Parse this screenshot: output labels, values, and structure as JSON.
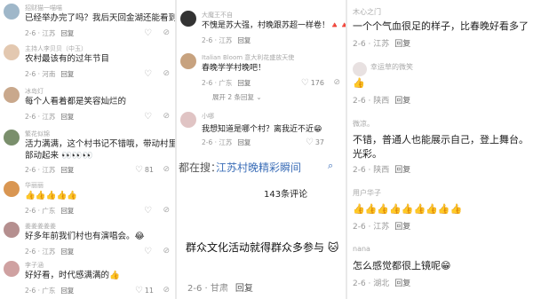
{
  "left": [
    {
      "user": "招财猫一喵喵",
      "text": "已经举办完了吗？我后天回金湖还能看到吗？",
      "time": "2-6 · 江苏",
      "likes": "",
      "color": "#9fb7c9"
    },
    {
      "user": "主持人李贝贝（中玉）",
      "text": "农村最该有的过年节目",
      "time": "2-6 · 河南",
      "likes": "",
      "color": "#e3c8b0"
    },
    {
      "user": "冰岛灯",
      "text": "每个人看着都是笑容灿烂的",
      "time": "2-6 · 江苏",
      "likes": "",
      "color": "#c9a88c"
    },
    {
      "user": "繁花似锦",
      "text": "活力满满，这个村书记不错哦，带动村里人全",
      "text2": "部动起来 👀👀👀",
      "time": "2-6 · 江苏",
      "likes": "81",
      "color": "#7a8f6c"
    },
    {
      "user": "华丽丽",
      "text": "👍👍👍👍👍",
      "time": "2-6 · 广东",
      "likes": "",
      "color": "#d99652"
    },
    {
      "user": "姜姜姜姜姜",
      "text": "好多年前我们村也有演唱会。😂",
      "time": "2-6 · 江苏",
      "likes": "",
      "color": "#b58f8f"
    },
    {
      "user": "李子涵",
      "text": "好好看，时代感满满的👍",
      "time": "2-6 · 广东",
      "likes": "11",
      "color": "#cfa1a1"
    }
  ],
  "middle": {
    "comments": [
      {
        "user": "大魔王不自",
        "text": "不愧是苏大强，村晚跟苏超一样卷！🔺🔺🔺",
        "time": "2-6 · 江苏",
        "likes": "",
        "color": "#333333"
      },
      {
        "user": "Italian Bloom 意大利花盛放天使",
        "text": "春晚学学村晚吧！",
        "time": "2-6 · 广东",
        "likes": "176",
        "color": "#c7a27f"
      },
      {
        "user": "小哪",
        "text": "我想知道是哪个村？离我近不近😁",
        "time": "2-6 · 江苏",
        "likes": "37",
        "color": "#e0c4c4"
      }
    ],
    "expand_text": "展开 2 条回复 ⌄",
    "search_prefix": "都在搜：",
    "search_link": "江苏村晚精彩瞬间",
    "search_icon": "search-icon",
    "comment_count": "143条评论",
    "big_comment": "群众文化活动就得群众多参与 🐱",
    "big_time": "2-6 · 甘肃",
    "reply": "回复"
  },
  "right": [
    {
      "user": "木心之门",
      "text": "一个个气血很足的样子，比春晚好看多了",
      "time": "2-6 · 江苏",
      "color": ""
    },
    {
      "user": "幸运草的微笑",
      "text": "👍",
      "time": "2-6 · 陕西",
      "color": "#e8e1e1"
    },
    {
      "user": "微凉。",
      "text": "不错，普通人也能展示自己，登上舞台。",
      "text2": "光彩。",
      "time": "2-6 · 陕西",
      "color": ""
    },
    {
      "user": "用户华子",
      "text": "👍👍👍👍👍👍👍👍👍",
      "time": "2-6 · 江苏",
      "color": ""
    },
    {
      "user": "nana",
      "text": "怎么感觉都很上镜呢😁",
      "time": "2-6 · 湖北",
      "color": ""
    }
  ],
  "reply_label": "回复",
  "dislike_icon": "dislike-icon"
}
